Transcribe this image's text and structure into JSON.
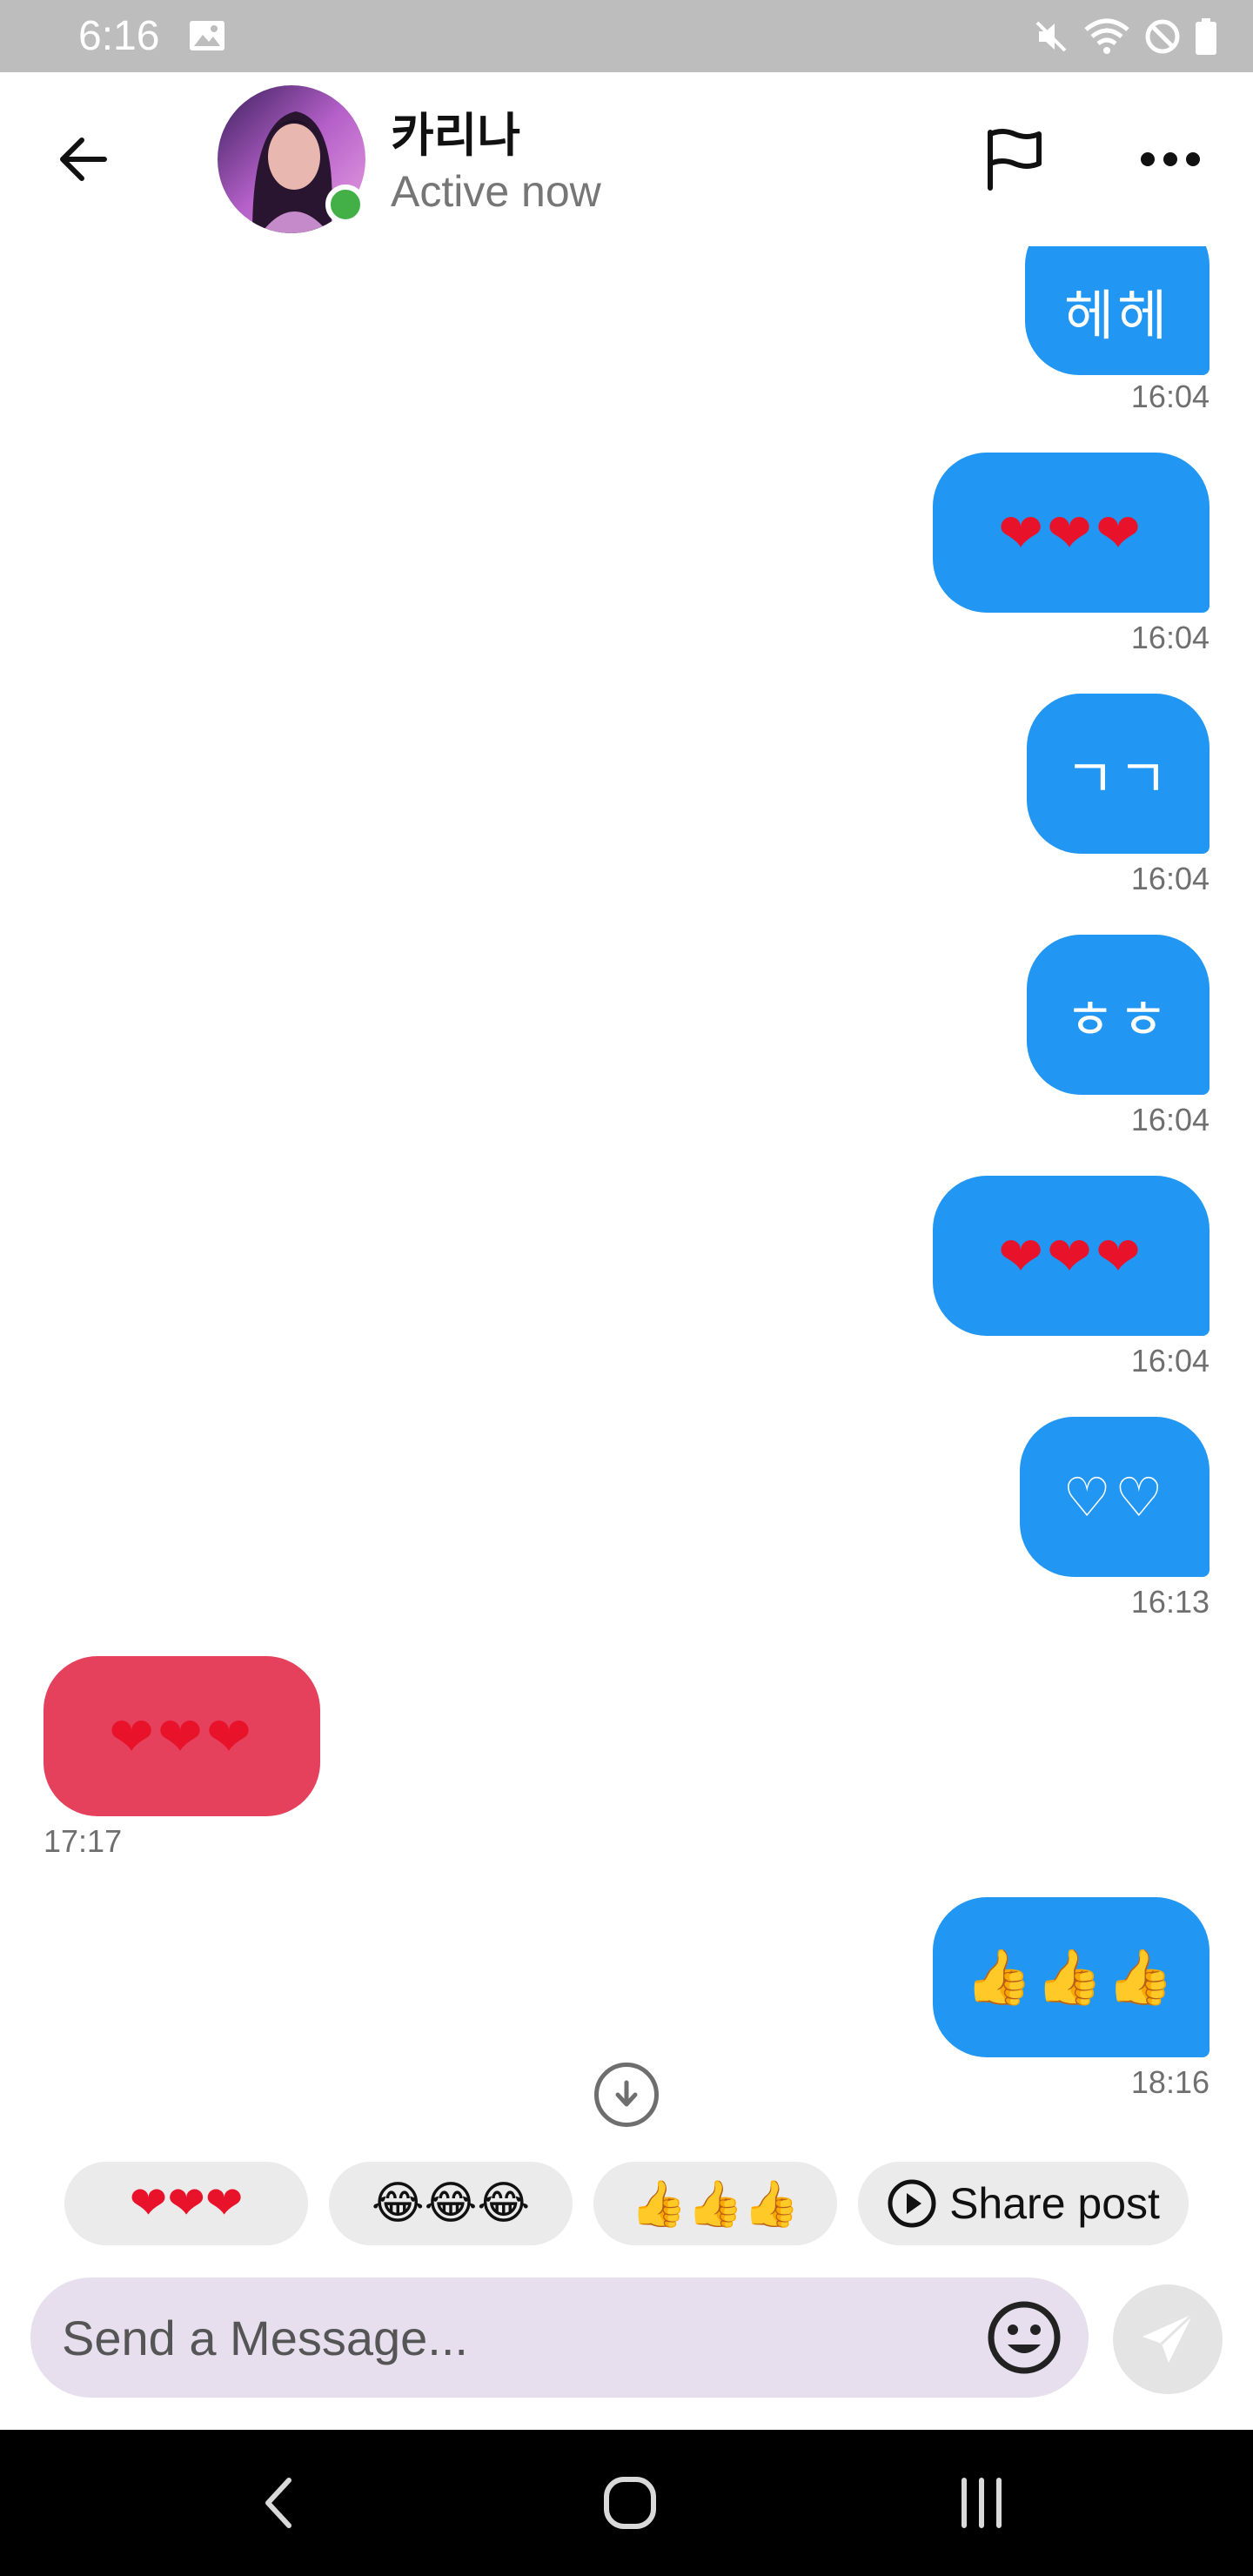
{
  "status_bar": {
    "time": "6:16",
    "icons": [
      "gallery-icon",
      "mute-icon",
      "wifi-icon",
      "do-not-disturb-icon",
      "battery-icon"
    ]
  },
  "header": {
    "contact_name": "카리나",
    "contact_status": "Active now",
    "online": true,
    "icons": [
      "back-arrow-icon",
      "flag-icon",
      "more-icon"
    ]
  },
  "messages": [
    {
      "direction": "out",
      "text": "헤헤",
      "time": "16:04"
    },
    {
      "direction": "out",
      "text": "❤❤❤",
      "time": "16:04"
    },
    {
      "direction": "out",
      "text": "ㄱㄱ",
      "time": "16:04"
    },
    {
      "direction": "out",
      "text": "ㅎㅎ",
      "time": "16:04"
    },
    {
      "direction": "out",
      "text": "❤❤❤",
      "time": "16:04"
    },
    {
      "direction": "out",
      "text": "♡♡",
      "time": "16:13"
    },
    {
      "direction": "in",
      "text": "❤❤❤",
      "time": "17:17"
    },
    {
      "direction": "out",
      "text": "👍👍👍",
      "time": "18:16"
    }
  ],
  "quick_replies": [
    {
      "text": "❤❤❤"
    },
    {
      "text": "😂😂😂"
    },
    {
      "text": "👍👍👍"
    },
    {
      "text": "Share post",
      "icon": "play-circle-icon"
    }
  ],
  "composer": {
    "placeholder": "Send a Message...",
    "value": ""
  },
  "colors": {
    "outgoing_bubble": "#2196f3",
    "incoming_bubble": "#e5405c",
    "composer_bg": "#e7dfee",
    "online": "#43b047"
  },
  "nav_bar": {
    "icons": [
      "nav-back-icon",
      "nav-home-icon",
      "nav-recents-icon"
    ]
  }
}
